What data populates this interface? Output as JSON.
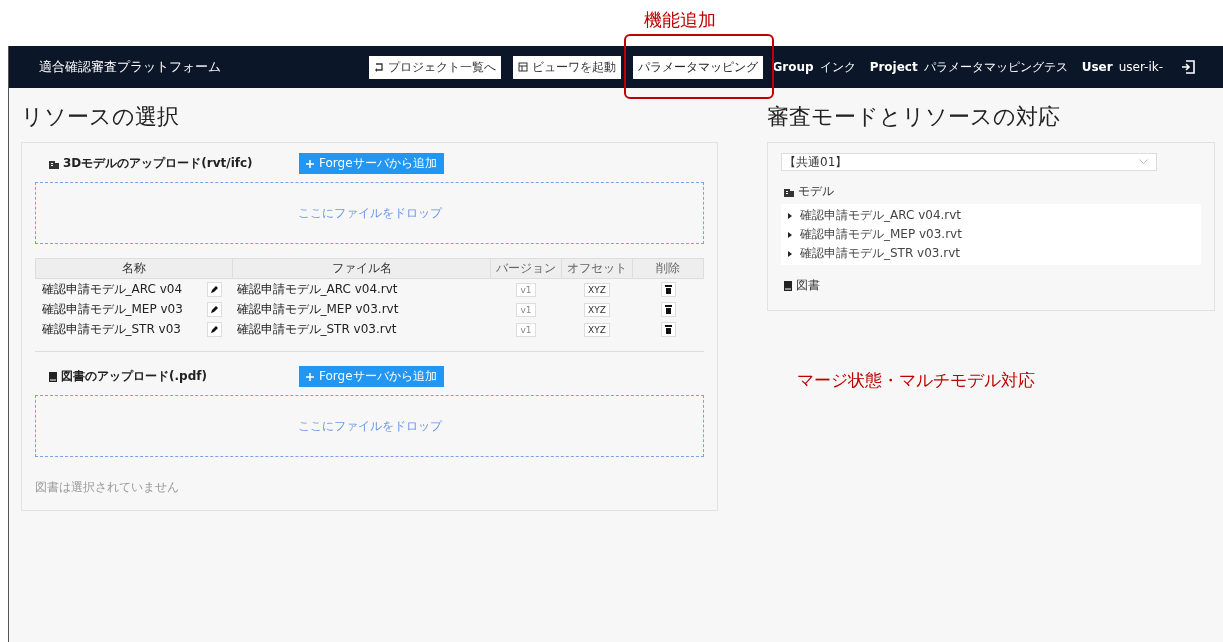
{
  "annotations": {
    "feature_label": "機能追加",
    "note": "マージ状態・マルチモデル対応"
  },
  "header": {
    "app_title": "適合確認審査プラットフォーム",
    "nav_buttons": [
      {
        "label": "プロジェクト一覧へ",
        "kind": "back",
        "highlighted": false
      },
      {
        "label": "ビューワを起動",
        "kind": "viewer",
        "highlighted": false
      },
      {
        "label": "パラメータマッピング",
        "kind": "plain",
        "highlighted": true
      }
    ],
    "info": [
      {
        "label": "Group",
        "value": "インク"
      },
      {
        "label": "Project",
        "value": "パラメータマッピングテス"
      },
      {
        "label": "User",
        "value": "user-ik-"
      }
    ]
  },
  "left": {
    "title": "リソースの選択",
    "model_section": {
      "heading": "3Dモデルのアップロード(rvt/ifc)",
      "add_button": "Forgeサーバから追加",
      "drop_text": "ここにファイルをドロップ"
    },
    "table": {
      "columns": [
        "名称",
        "ファイル名",
        "バージョン",
        "オフセット",
        "削除"
      ],
      "rows": [
        {
          "name": "確認申請モデル_ARC v04",
          "file": "確認申請モデル_ARC v04.rvt",
          "version": "v1",
          "version_disabled": true,
          "offset": "XYZ"
        },
        {
          "name": "確認申請モデル_MEP v03",
          "file": "確認申請モデル_MEP v03.rvt",
          "version": "v1",
          "version_disabled": true,
          "offset": "XYZ"
        },
        {
          "name": "確認申請モデル_STR v03",
          "file": "確認申請モデル_STR v03.rvt",
          "version": "v1",
          "version_disabled": true,
          "offset": "XYZ"
        }
      ]
    },
    "drawing_section": {
      "heading": "図書のアップロード(.pdf)",
      "add_button": "Forgeサーバから追加",
      "drop_text": "ここにファイルをドロップ",
      "empty_text": "図書は選択されていません"
    }
  },
  "right": {
    "title": "審査モードとリソースの対応",
    "mode_select": "【共通01】",
    "models_heading": "モデル",
    "models": [
      {
        "label": "確認申請モデル_ARC v04.rvt",
        "expanded": false
      },
      {
        "label": "確認申請モデル_MEP v03.rvt",
        "expanded": false
      },
      {
        "label": "確認申請モデル_STR v03.rvt",
        "expanded": false
      }
    ],
    "drawings_heading": "図書"
  }
}
